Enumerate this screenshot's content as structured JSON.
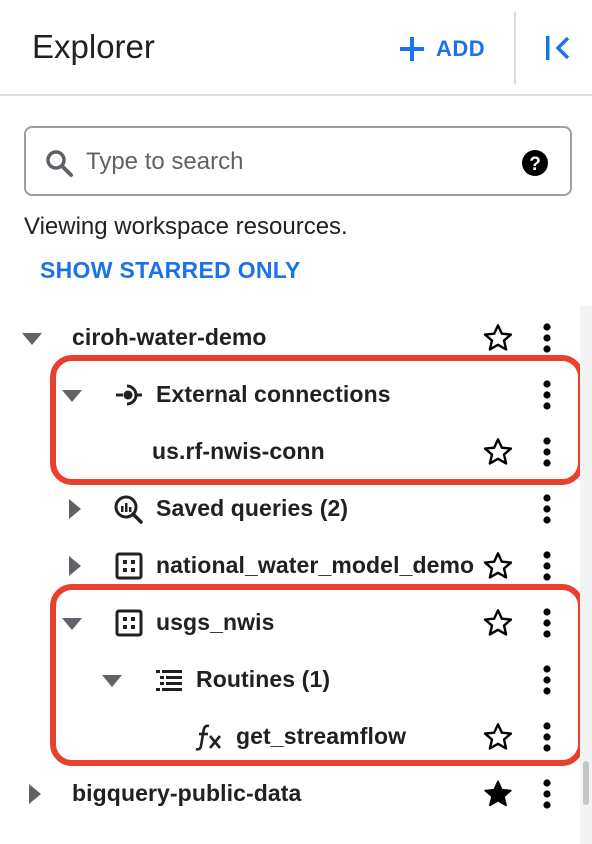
{
  "header": {
    "title": "Explorer",
    "add_label": "ADD"
  },
  "search": {
    "placeholder": "Type to search"
  },
  "info_text": "Viewing workspace resources.",
  "starred_link": "SHOW STARRED ONLY",
  "tree": {
    "project1": {
      "label": "ciroh-water-demo",
      "icon": "caret-down-icon",
      "starred": false
    },
    "external_connections": {
      "label": "External connections",
      "icon": "connection-icon"
    },
    "connection": {
      "label": "us.rf-nwis-conn",
      "starred": false
    },
    "saved_queries": {
      "label": "Saved queries (2)",
      "icon": "saved-query-icon"
    },
    "dataset1": {
      "label": "national_water_model_demo",
      "icon": "dataset-icon",
      "starred": false
    },
    "dataset2": {
      "label": "usgs_nwis",
      "icon": "dataset-icon",
      "starred": false
    },
    "routines": {
      "label": "Routines (1)",
      "icon": "routines-icon"
    },
    "routine": {
      "label": "get_streamflow",
      "icon": "function-icon",
      "starred": false
    },
    "project2": {
      "label": "bigquery-public-data",
      "starred": true
    }
  },
  "colors": {
    "accent": "#1a73e8",
    "highlight": "#e8402d",
    "text": "#202124"
  }
}
